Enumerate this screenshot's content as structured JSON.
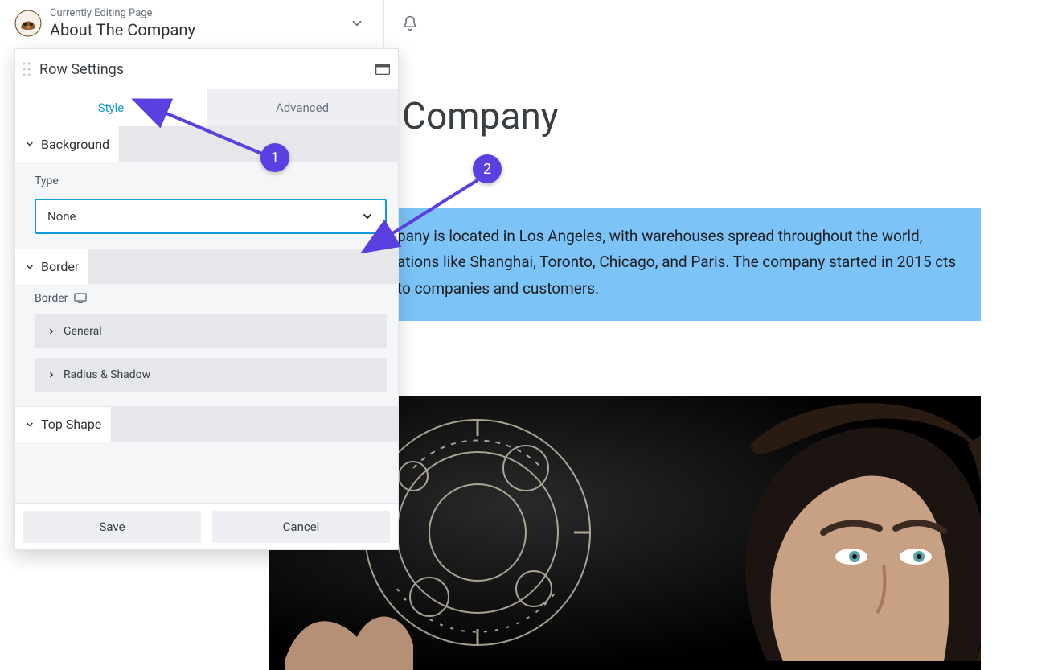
{
  "topbar": {
    "editing_label": "Currently Editing Page",
    "page_title": "About The Company"
  },
  "panel": {
    "title": "Row Settings",
    "tabs": {
      "style": "Style",
      "advanced": "Advanced"
    },
    "sections": {
      "background": {
        "label": "Background"
      },
      "type_field": {
        "label": "Type",
        "selected": "None"
      },
      "border": {
        "label": "Border",
        "sub_label": "Border",
        "general": "General",
        "radius_shadow": "Radius & Shadow"
      },
      "top_shape": {
        "label": "Top Shape"
      }
    },
    "footer": {
      "save": "Save",
      "cancel": "Cancel"
    }
  },
  "content": {
    "heading_visible": "Company",
    "paragraph": "pany is located in Los Angeles, with warehouses spread throughout the world, ations like Shanghai, Toronto, Chicago, and Paris. The company started in 2015 cts to companies and customers."
  },
  "annotations": {
    "one": "1",
    "two": "2"
  }
}
